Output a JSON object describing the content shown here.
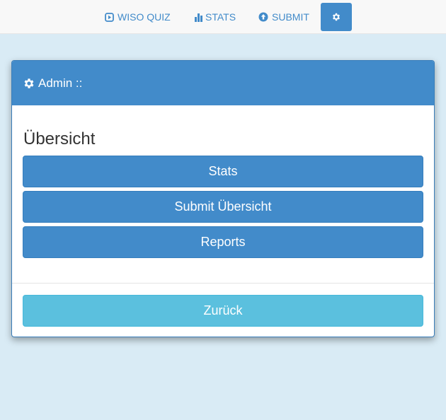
{
  "navbar": {
    "items": [
      {
        "label": "WISO QUIZ",
        "icon": "play-icon"
      },
      {
        "label": "STATS",
        "icon": "bar-chart-icon"
      },
      {
        "label": "SUBMIT",
        "icon": "upload-circle-icon"
      },
      {
        "label": "",
        "icon": "gear-icon"
      }
    ]
  },
  "panel": {
    "heading": "Admin ::",
    "heading_icon": "gear-icon",
    "section_title": "Übersicht",
    "buttons": {
      "stats": "Stats",
      "submit_overview": "Submit Übersicht",
      "reports": "Reports"
    },
    "back_label": "Zurück"
  },
  "colors": {
    "primary": "#428bca",
    "info": "#5bc0de",
    "background": "#d9ebf5",
    "navbar_bg": "#f8f8f8"
  }
}
